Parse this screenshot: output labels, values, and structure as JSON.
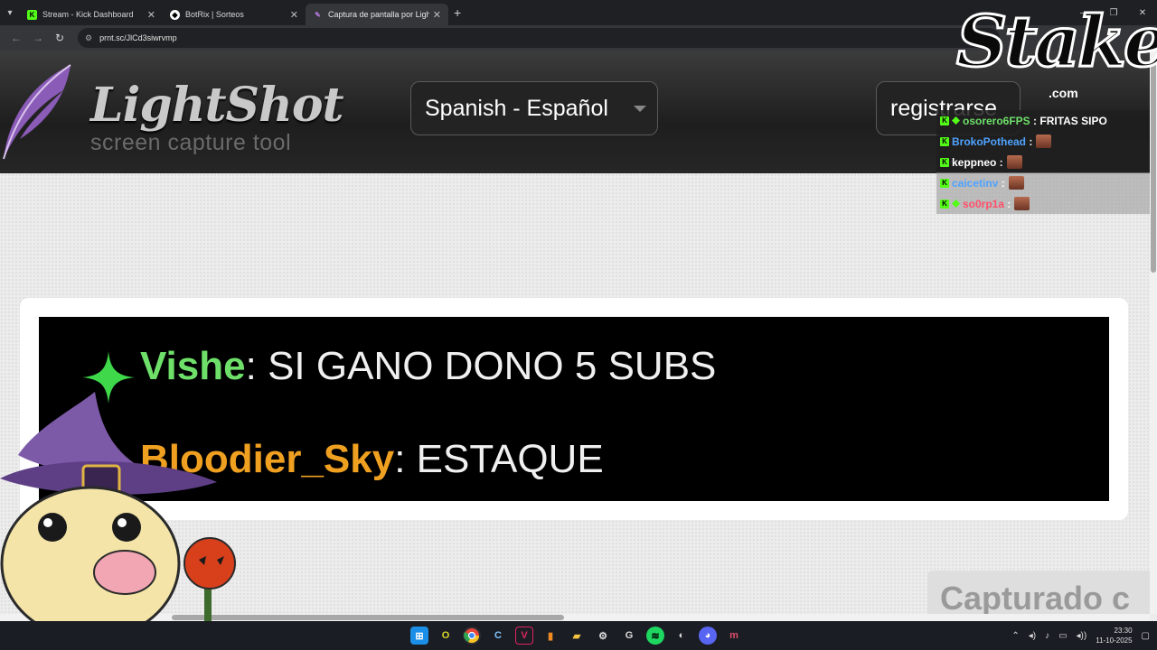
{
  "browser": {
    "tabs": [
      {
        "title": "Stream - Kick Dashboard",
        "favicon": "kick-icon"
      },
      {
        "title": "BotRix | Sorteos",
        "favicon": "botrix-icon"
      },
      {
        "title": "Captura de pantalla por Lightsh",
        "favicon": "lightshot-icon",
        "active": true
      }
    ],
    "url": "prnt.sc/JlCd3siwrvmp"
  },
  "lightshot": {
    "brand": "LightShot",
    "tagline": "screen capture tool",
    "language": "Spanish - Español",
    "register": "registrarse",
    "captured_label": "Capturado c"
  },
  "screenshot": {
    "messages": [
      {
        "user": "Vishe",
        "text": "SI GANO DONO 5 SUBS",
        "user_color": "#6ee06a"
      },
      {
        "user": "Bloodier_Sky",
        "text": "ESTAQUE",
        "user_color": "#f0a020"
      }
    ]
  },
  "overlay": {
    "stake_logo": "Stake",
    "stake_domain": ".com",
    "chat": [
      {
        "user": "osorero6FPS",
        "text": "FRITAS SIPO",
        "color": "#6ee06a",
        "emote": false
      },
      {
        "user": "BrokoPothead",
        "text": "",
        "color": "#4fa3ff",
        "emote": true
      },
      {
        "user": "keppneo",
        "text": "",
        "color": "#ffffff",
        "emote": true
      },
      {
        "user": "caicetinv",
        "text": "",
        "color": "#4fa3ff",
        "emote": true
      },
      {
        "user": "so0rp1a",
        "text": "",
        "color": "#ff4f6a",
        "emote": true
      }
    ]
  },
  "taskbar": {
    "time": "23:30",
    "date": "11-10-2025"
  }
}
